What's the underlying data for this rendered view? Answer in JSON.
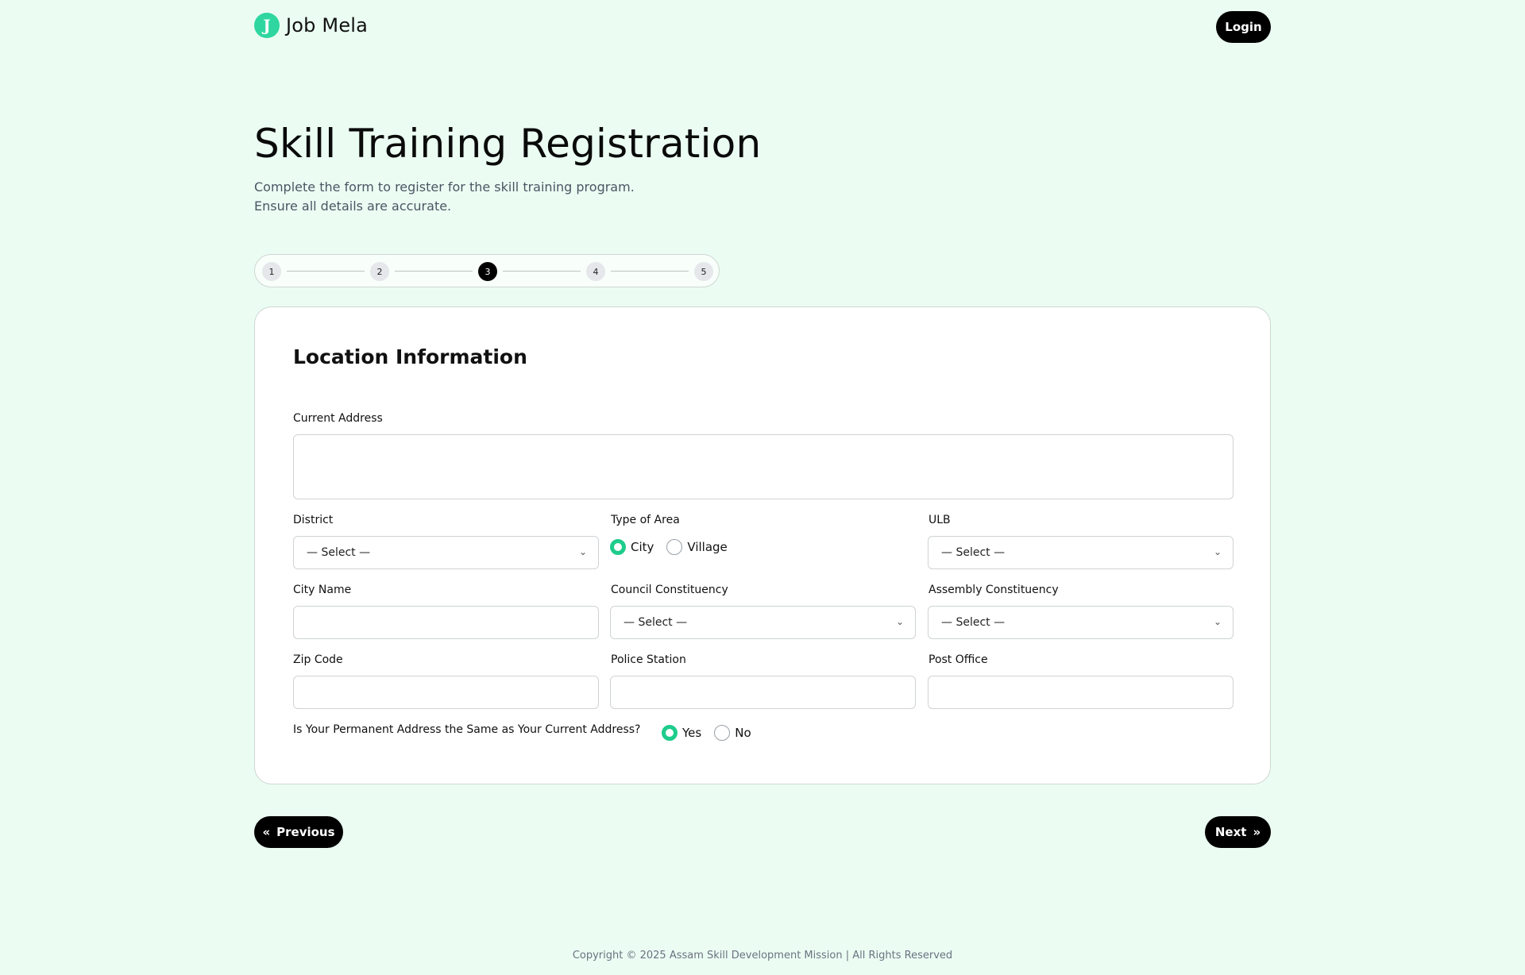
{
  "header": {
    "logo_letter": "J",
    "brand": "Job Mela",
    "login_label": "Login"
  },
  "page": {
    "title": "Skill Training Registration",
    "subtitle_line1": "Complete the form to register for the skill training program.",
    "subtitle_line2": "Ensure all details are accurate."
  },
  "stepper": {
    "steps": [
      "1",
      "2",
      "3",
      "4",
      "5"
    ],
    "current": 3
  },
  "form": {
    "section_title": "Location Information",
    "current_address_label": "Current Address",
    "district_label": "District",
    "district_value": "— Select —",
    "type_of_area_label": "Type of Area",
    "area_options": [
      "City",
      "Village"
    ],
    "area_selected": "City",
    "ulb_label": "ULB",
    "ulb_value": "— Select —",
    "city_name_label": "City Name",
    "council_label": "Council Constituency",
    "council_value": "— Select —",
    "assembly_label": "Assembly Constituency",
    "assembly_value": "— Select —",
    "zip_label": "Zip Code",
    "police_label": "Police Station",
    "post_office_label": "Post Office",
    "same_address_question": "Is Your Permanent Address the Same as Your Current Address?",
    "same_address_options": [
      "Yes",
      "No"
    ],
    "same_address_selected": "Yes"
  },
  "nav": {
    "previous_label": "Previous",
    "next_label": "Next"
  },
  "footer": {
    "copyright": "Copyright © 2025 Assam Skill Development Mission | All Rights Reserved"
  },
  "colors": {
    "background": "#ebfdf3",
    "accent": "#1ecc8c",
    "primary_button": "#000000"
  }
}
